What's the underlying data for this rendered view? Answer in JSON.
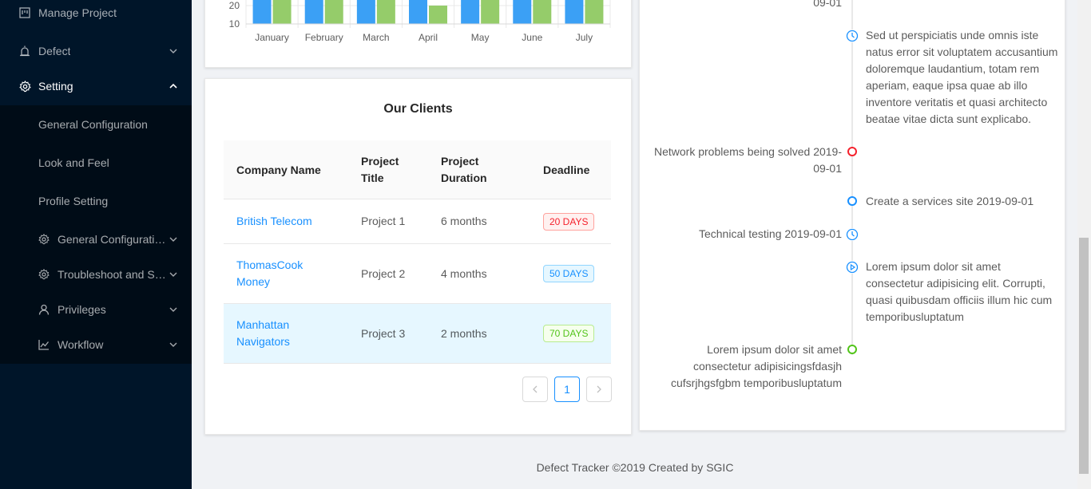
{
  "sidebar": {
    "items": [
      {
        "label": "Manage Project",
        "icon": "project-icon"
      },
      {
        "label": "Defect",
        "icon": "bug-icon"
      },
      {
        "label": "Setting",
        "icon": "gear-icon"
      }
    ],
    "submenu": [
      {
        "label": "General Configuration"
      },
      {
        "label": "Look and Feel"
      },
      {
        "label": "Profile Setting"
      },
      {
        "label": "General Configuration",
        "icon": "gear-icon"
      },
      {
        "label": "Troubleshoot and Support",
        "icon": "gear-icon"
      },
      {
        "label": "Privileges",
        "icon": "user-icon"
      },
      {
        "label": "Workflow",
        "icon": "line-chart-icon"
      }
    ]
  },
  "chart_data": {
    "type": "bar",
    "categories": [
      "January",
      "February",
      "March",
      "April",
      "May",
      "June",
      "July"
    ],
    "y_tick_labels": [
      "20",
      "10"
    ],
    "colors": [
      "#3ba0f5",
      "#95cc6a"
    ],
    "series": [
      {
        "values": [
          31,
          31,
          31,
          31,
          31,
          31,
          31
        ]
      },
      {
        "values": [
          31,
          31,
          31,
          20,
          31,
          31,
          31
        ]
      }
    ],
    "ylim": [
      0,
      35
    ]
  },
  "clients": {
    "title": "Our Clients",
    "headers": {
      "company": "Company Name",
      "title": "Project Title",
      "duration": "Project Duration",
      "deadline": "Deadline"
    },
    "rows": [
      {
        "company": "British Telecom",
        "title": "Project 1",
        "duration": "6 months",
        "deadline": "20 DAYS",
        "status": "red"
      },
      {
        "company": "ThomasCook Money",
        "title": "Project 2",
        "duration": "4 months",
        "deadline": "50 DAYS",
        "status": "blue"
      },
      {
        "company": "Manhattan Navigators",
        "title": "Project 3",
        "duration": "2 months",
        "deadline": "70 DAYS",
        "status": "green"
      }
    ],
    "pagination": {
      "current": "1"
    }
  },
  "timeline": {
    "top_partial": "09-01",
    "items": [
      {
        "text": "Sed ut perspiciatis unde omnis iste natus error sit voluptatem accusantium doloremque laudantium, totam rem aperiam, eaque ipsa quae ab illo inventore veritatis et quasi architecto beatae vitae dicta sunt explicabo.",
        "icon": "clock-icon"
      },
      {
        "text": "Network problems being solved 2019-09-01",
        "color": "#f5222d"
      },
      {
        "text": "Create a services site 2019-09-01",
        "color": "#1890ff"
      },
      {
        "text": "Technical testing 2019-09-01",
        "icon": "clock-icon"
      },
      {
        "text": "Lorem ipsum dolor sit amet consectetur adipisicing elit. Corrupti, quasi quibusdam officiis illum hic cum temporibusluptatum",
        "icon": "play-circle-icon"
      },
      {
        "text": "Lorem ipsum dolor sit amet consectetur adipisicingsfdasjh cufsrjhgsfgbm temporibusluptatum",
        "color": "#52c41a"
      }
    ]
  },
  "footer": {
    "text": "Defect Tracker ©2019 Created by SGIC"
  }
}
